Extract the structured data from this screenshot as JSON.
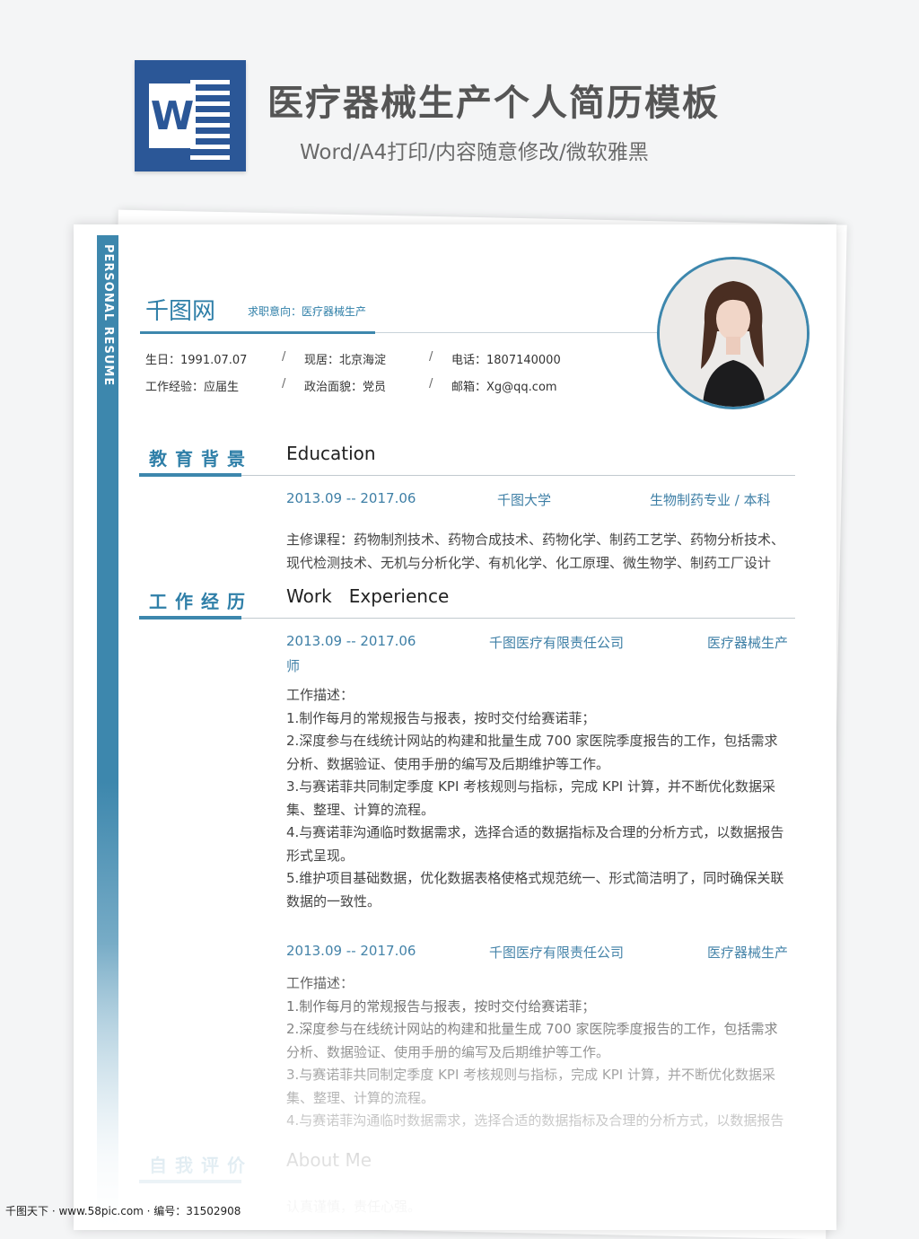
{
  "header": {
    "icon_letter": "W",
    "title": "医疗器械生产个人简历模板",
    "subtitle": "Word/A4打印/内容随意修改/微软雅黑"
  },
  "resume": {
    "side_label": "PERSONAL RESUME",
    "name": "千图网",
    "intent": "求职意向：医疗器械生产",
    "info": {
      "birthday": "生日：1991.07.07",
      "residence": "现居：北京海淀",
      "phone": "电话：1807140000",
      "experience": "工作经验：应届生",
      "politics": "政治面貌：党员",
      "email": "邮箱：Xg@qq.com",
      "separator": "/"
    },
    "education": {
      "title_cn": "教育背景",
      "title_en": "Education",
      "period": "2013.09 -- 2017.06",
      "school": "千图大学",
      "major": "生物制药专业 / 本科",
      "courses": [
        "主修课程：药物制剂技术、药物合成技术、药物化学、制药工艺学、药物分析技术、",
        "现代检测技术、无机与分析化学、有机化学、化工原理、微生物学、制药工厂设计"
      ]
    },
    "work": {
      "title_cn": "工作经历",
      "title_en": "Work   Experience",
      "jobs": [
        {
          "period": "2013.09 -- 2017.06",
          "company": "千图医疗有限责任公司",
          "position": "医疗器械生产",
          "position_wrap": "师",
          "lines": [
            "工作描述：",
            "1.制作每月的常规报告与报表，按时交付给赛诺菲；",
            "2.深度参与在线统计网站的构建和批量生成 700 家医院季度报告的工作，包括需求",
            "分析、数据验证、使用手册的编写及后期维护等工作。",
            "3.与赛诺菲共同制定季度 KPI 考核规则与指标，完成 KPI 计算，并不断优化数据采",
            "集、整理、计算的流程。",
            "4.与赛诺菲沟通临时数据需求，选择合适的数据指标及合理的分析方式，以数据报告",
            "形式呈现。",
            "5.维护项目基础数据，优化数据表格使格式规范统一、形式简洁明了，同时确保关联",
            "数据的一致性。"
          ]
        },
        {
          "period": "2013.09 -- 2017.06",
          "company": "千图医疗有限责任公司",
          "position": "医疗器械生产",
          "lines": [
            "工作描述：",
            "1.制作每月的常规报告与报表，按时交付给赛诺菲；",
            "2.深度参与在线统计网站的构建和批量生成 700 家医院季度报告的工作，包括需求",
            "分析、数据验证、使用手册的编写及后期维护等工作。",
            "3.与赛诺菲共同制定季度 KPI 考核规则与指标，完成 KPI 计算，并不断优化数据采",
            "集、整理、计算的流程。",
            "4.与赛诺菲沟通临时数据需求，选择合适的数据指标及合理的分析方式，以数据报告"
          ]
        }
      ]
    },
    "about": {
      "title_cn": "自我评价",
      "title_en": "About Me",
      "text": "认真谨慎，责任心强。"
    }
  },
  "watermark": "千图天下 · www.58pic.com · 编号：31502908",
  "colors": {
    "accent": "#3d87ad",
    "word_blue": "#2b5797"
  }
}
